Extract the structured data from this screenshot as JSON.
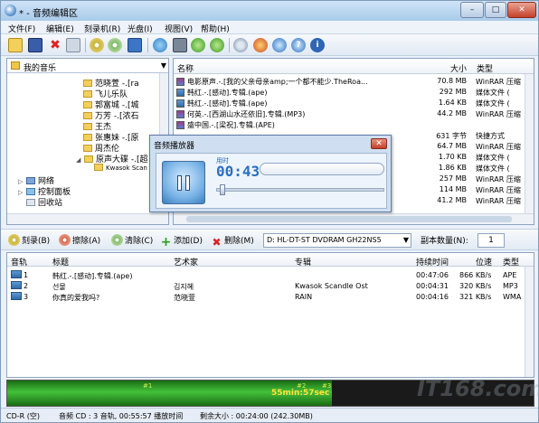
{
  "window": {
    "title": "* - 音频编辑区"
  },
  "menu": [
    "文件(F)",
    "编辑(E)",
    "刻录机(R)",
    "光盘(I)",
    "视图(V)",
    "帮助(H)"
  ],
  "left": {
    "root": "我的音乐",
    "items": [
      {
        "label": "范晓萱 -.[ra"
      },
      {
        "label": "飞儿乐队"
      },
      {
        "label": "郭富城 -.[城"
      },
      {
        "label": "万芳 -.[浓石"
      },
      {
        "label": "王杰"
      },
      {
        "label": "张惠妹 -.[原"
      },
      {
        "label": "周杰伦"
      },
      {
        "label": "原声大碟 -.[超"
      },
      {
        "label": "Kwasok Scan"
      },
      {
        "label": "网络"
      },
      {
        "label": "控制面板"
      },
      {
        "label": "回收站"
      }
    ]
  },
  "files": {
    "headers": {
      "name": "名称",
      "size": "大小",
      "type": "类型"
    },
    "rows": [
      {
        "name": "电影原声.-.[我的父亲母亲amp;一个都不能少.TheRoa...",
        "size": "70.8 MB",
        "type": "WinRAR 压缩"
      },
      {
        "name": "韩红.-.[感动].专辑.(ape)",
        "size": "292 MB",
        "type": "媒体文件 ("
      },
      {
        "name": "韩红.-.[感动].专辑.(ape)",
        "size": "1.64 KB",
        "type": "媒体文件 ("
      },
      {
        "name": "何英.-.[西湖山水还依旧].专辑.(MP3)",
        "size": "44.2 MB",
        "type": "WinRAR 压缩"
      },
      {
        "name": "盛中国.-.[梁祝].专辑.(APE)",
        "size": "",
        "type": ""
      },
      {
        "name": "",
        "size": "631 字节",
        "type": "快捷方式"
      },
      {
        "name": "",
        "size": "64.7 MB",
        "type": "WinRAR 压缩"
      },
      {
        "name": "",
        "size": "1.70 KB",
        "type": "媒体文件 ("
      },
      {
        "name": "",
        "size": "1.86 KB",
        "type": "媒体文件 ("
      },
      {
        "name": "",
        "size": "257 MB",
        "type": "WinRAR 压缩"
      },
      {
        "name": "",
        "size": "114 MB",
        "type": "WinRAR 压缩"
      },
      {
        "name": "",
        "size": "41.2 MB",
        "type": "WinRAR 压缩"
      }
    ]
  },
  "player": {
    "title": "音频播放器",
    "time_label": "用时",
    "time": "00:43"
  },
  "toolbar2": {
    "burn": "刻录(B)",
    "erase": "擦除(A)",
    "clear": "清除(C)",
    "add": "添加(D)",
    "delete": "删除(M)",
    "drive": "D: HL-DT-ST DVDRAM GH22NS5",
    "copies_label": "副本数量(N):",
    "copies": "1"
  },
  "tracks": {
    "headers": {
      "no": "音轨",
      "title": "标题",
      "artist": "艺术家",
      "album": "专辑",
      "duration": "持续时间",
      "bitrate": "位速",
      "type": "类型"
    },
    "rows": [
      {
        "no": "1",
        "title": "韩红.-.[感动].专辑.(ape)",
        "artist": "",
        "album": "",
        "duration": "00:47:06",
        "bitrate": "866 KB/s",
        "type": "APE"
      },
      {
        "no": "2",
        "title": "선물",
        "artist": "김지혜",
        "album": "Kwasok Scandle Ost",
        "duration": "00:04:31",
        "bitrate": "320 KB/s",
        "type": "MP3"
      },
      {
        "no": "3",
        "title": "你真的爱我吗?",
        "artist": "范晓萱",
        "album": "RAIN",
        "duration": "00:04:16",
        "bitrate": "321 KB/s",
        "type": "WMA"
      }
    ]
  },
  "timeline": {
    "marks": [
      "#1",
      "#2",
      "#3"
    ],
    "total": "55min:57sec",
    "fill_fraction": 0.617
  },
  "watermark": "IT168.com",
  "status": {
    "media": "CD-R (空)",
    "info": "音频 CD : 3 音轨, 00:55:57 播放时间",
    "remaining": "剩余大小 : 00:24:00 (242.30MB)"
  },
  "colors": {
    "timeline_fill": "#43c13a",
    "timeline_text": "#ffe33a",
    "accent": "#2a6fc1"
  }
}
